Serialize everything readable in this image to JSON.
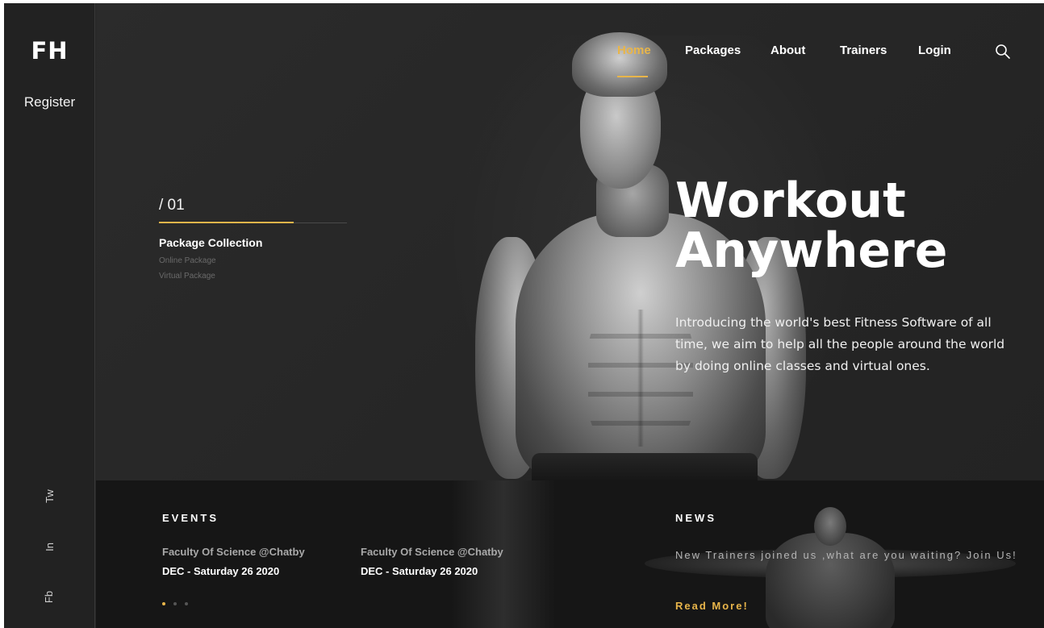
{
  "brand": {
    "logo": "FH"
  },
  "sidebar": {
    "register_label": "Register",
    "social": [
      {
        "label": "Tw",
        "icon": "twitter-icon"
      },
      {
        "label": "In",
        "icon": "linkedin-icon"
      },
      {
        "label": "Fb",
        "icon": "facebook-icon"
      }
    ]
  },
  "nav": {
    "items": [
      {
        "label": "Home",
        "active": true
      },
      {
        "label": "Packages",
        "active": false
      },
      {
        "label": "About",
        "active": false
      },
      {
        "label": "Trainers",
        "active": false
      },
      {
        "label": "Login",
        "active": false
      }
    ],
    "search_icon": "search-icon"
  },
  "hero": {
    "slide_number": "/ 01",
    "package_title": "Package Collection",
    "package_links": [
      "Online Package",
      "Virtual Package"
    ],
    "headline_line1": "Workout",
    "headline_line2": "Anywhere",
    "intro": "Introducing the world's best Fitness Software of all time, we aim to help all the people around the world by doing online classes and virtual ones."
  },
  "events": {
    "title": "EVENTS",
    "items": [
      {
        "place": "Faculty Of Science @Chatby",
        "date": "DEC - Saturday 26 2020"
      },
      {
        "place": "Faculty Of Science @Chatby",
        "date": "DEC - Saturday 26 2020"
      }
    ],
    "dots": 3,
    "active_dot": 0
  },
  "news": {
    "title": "NEWS",
    "text": "New Trainers joined us ,what are you waiting? Join Us!",
    "read_more": "Read More!"
  },
  "colors": {
    "accent": "#e8b54a",
    "background": "#262626",
    "band": "#161616"
  }
}
